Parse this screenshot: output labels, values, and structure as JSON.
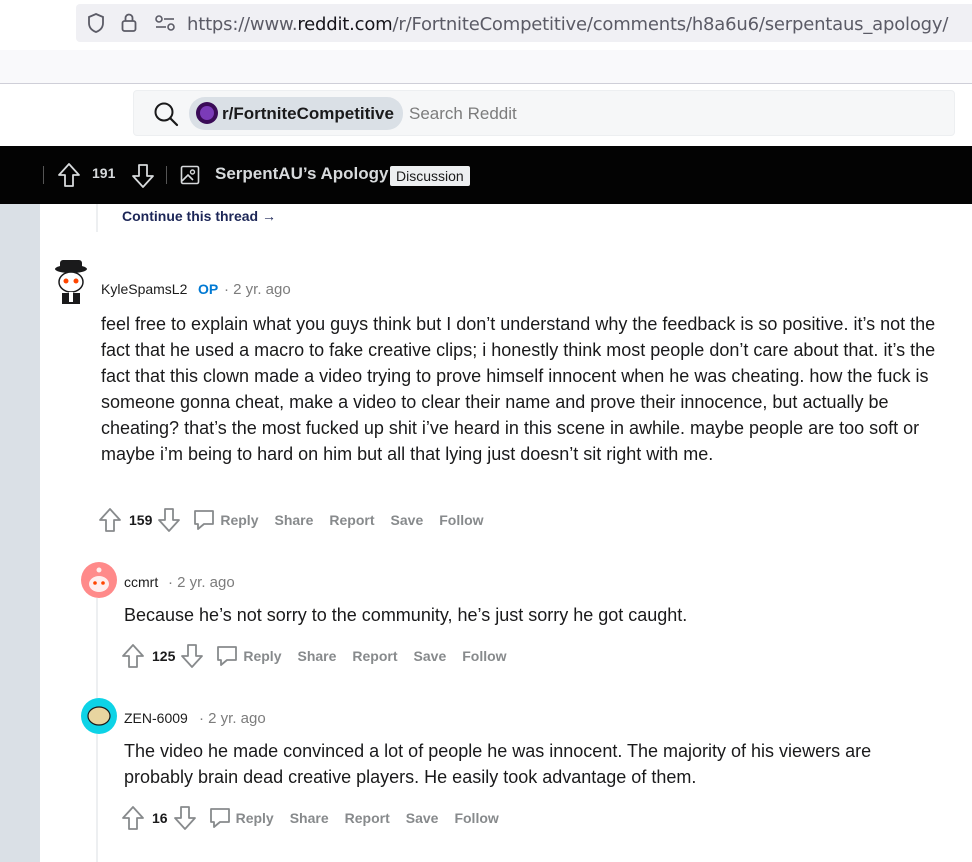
{
  "browser": {
    "url_prefix": "https://www.",
    "url_host": "reddit.com",
    "url_path": "/r/FortniteCompetitive/comments/h8a6u6/serpentaus_apology/"
  },
  "header": {
    "subreddit": "r/FortniteCompetitive",
    "search_placeholder": "Search Reddit"
  },
  "postbar": {
    "score": "191",
    "title": "SerpentAU’s Apology",
    "flair": "Discussion"
  },
  "thread": {
    "continue_label": "Continue this thread"
  },
  "comments": [
    {
      "author": "KyleSpamsL2",
      "op_label": "OP",
      "time": "2 yr. ago",
      "text": "feel free to explain what you guys think but I don’t understand why the feedback is so positive. it’s not the fact that he used a macro to fake creative clips; i honestly think most people don’t care about that. it’s the fact that this clown made a video trying to prove himself innocent when he was cheating. how the fuck is someone gonna cheat, make a video to clear their name and prove their innocence, but actually be cheating? that’s the most fucked up shit i’ve heard in this scene in awhile. maybe people are too soft or maybe i’m being to hard on him but all that lying just doesn’t sit right with me.",
      "score": "159"
    },
    {
      "author": "ccmrt",
      "time": "2 yr. ago",
      "text": "Because he’s not sorry to the community, he’s just sorry he got caught.",
      "score": "125"
    },
    {
      "author": "ZEN-6009",
      "time": "2 yr. ago",
      "text": "The video he made convinced a lot of people he was innocent. The majority of his viewers are probably brain dead creative players. He easily took advantage of them.",
      "score": "16"
    }
  ],
  "actions": {
    "reply": "Reply",
    "share": "Share",
    "report": "Report",
    "save": "Save",
    "follow": "Follow"
  },
  "separator": "·"
}
